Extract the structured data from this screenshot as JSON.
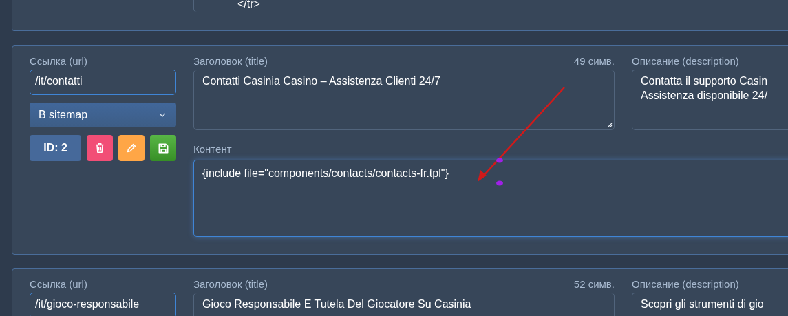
{
  "top_card": {
    "content_tail": "</tr>"
  },
  "entries": [
    {
      "url_label": "Ссылка (url)",
      "url": "/it/contatti",
      "sitemap": "В sitemap",
      "id_badge": "ID: 2",
      "actions": [
        {
          "kind": "delete"
        },
        {
          "kind": "edit"
        },
        {
          "kind": "save"
        }
      ],
      "title_label": "Заголовок (title)",
      "title_count": "49 симв.",
      "title": "Contatti Casinia Casino – Assistenza Clienti 24/7",
      "resize_grip": true,
      "description_label": "Описание (description)",
      "description_lines": [
        "Contatta il supporto Casin",
        "Assistenza disponibile 24/"
      ],
      "content_label": "Контент",
      "content": "{include file=\"components/contacts/contacts-fr.tpl\"}",
      "content_focused": true
    },
    {
      "url_label": "Ссылка (url)",
      "url": "/it/gioco-responsabile",
      "title_label": "Заголовок (title)",
      "title_count": "52 симв.",
      "title": "Gioco Responsabile E Tutela Del Giocatore Su Casinia",
      "description_label": "Описание (description)",
      "description_lines": [
        "Scopri gli strumenti di gio"
      ]
    }
  ]
}
